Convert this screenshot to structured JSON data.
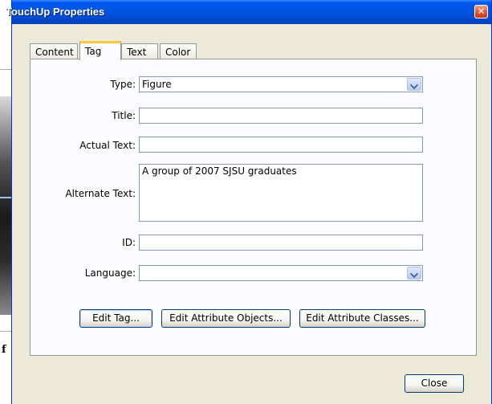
{
  "window": {
    "title": "TouchUp Properties"
  },
  "background": {
    "partial_text": "f"
  },
  "tabs": [
    {
      "label": "Content"
    },
    {
      "label": "Tag",
      "active": true
    },
    {
      "label": "Text"
    },
    {
      "label": "Color"
    }
  ],
  "form": {
    "type": {
      "label": "Type:",
      "value": "Figure"
    },
    "title": {
      "label": "Title:",
      "value": ""
    },
    "actual_text": {
      "label": "Actual Text:",
      "value": ""
    },
    "alternate_text": {
      "label": "Alternate Text:",
      "value": "A group of 2007 SJSU graduates"
    },
    "id": {
      "label": "ID:",
      "value": ""
    },
    "language": {
      "label": "Language:",
      "value": ""
    }
  },
  "buttons": {
    "edit_tag": "Edit Tag...",
    "edit_attribute_objects": "Edit Attribute Objects...",
    "edit_attribute_classes": "Edit Attribute Classes...",
    "close": "Close"
  },
  "icons": {
    "close": "close-icon",
    "dropdown": "chevron-down-icon"
  },
  "colors": {
    "titlebar": "#0054e3",
    "dialog_bg": "#ece9d8",
    "active_tab_accent": "#ffc83c",
    "close_button": "#e0502c"
  }
}
